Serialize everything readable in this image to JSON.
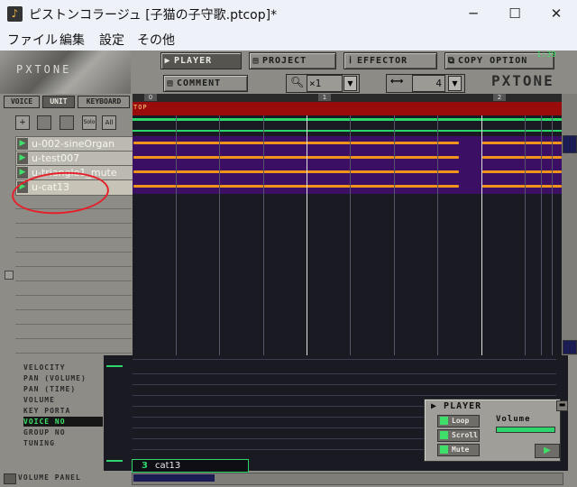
{
  "window": {
    "title": "ピストンコラージュ [子猫の子守歌.ptcop]*",
    "minimize": "─",
    "maximize": "☐",
    "close": "✕"
  },
  "menu": [
    "ファイル",
    "編集",
    "設定",
    "その他"
  ],
  "toolbar": {
    "player": "PLAYER",
    "project": "PROJECT",
    "effector": "EFFECTOR",
    "copy": "COPY",
    "option": "OPTION",
    "comment": "COMMENT",
    "zoom_value": "×1",
    "division_value": "4",
    "brand": "PXTONE",
    "counter": "1:39"
  },
  "left_tabs": [
    "VOICE",
    "UNIT",
    "KEYBOARD"
  ],
  "unit_buttons": [
    "+",
    "Solo",
    "All"
  ],
  "units": [
    {
      "name": "u-002-sineOrgan"
    },
    {
      "name": "u-test007"
    },
    {
      "name": "u-triangle1_mute"
    },
    {
      "name": "u-cat13"
    }
  ],
  "timeline": {
    "bars": [
      "0",
      "1",
      "2"
    ],
    "top_label": "TOP"
  },
  "params": [
    "VELOCITY",
    "PAN (VOLUME)",
    "PAN (TIME)",
    "VOLUME",
    "KEY PORTA",
    "VOICE NO",
    "GROUP NO",
    "TUNING"
  ],
  "active_param": "VOICE NO",
  "voice_indicator": {
    "number": "3",
    "name": "cat13"
  },
  "volume_panel": "VOLUME PANEL",
  "player_panel": {
    "title": "PLAYER",
    "loop": "Loop",
    "scroll": "Scroll",
    "mute": "Mute",
    "volume": "Volume"
  },
  "colors": {
    "accent_green": "#2ed56b",
    "note_orange": "#f0931d",
    "track_purple": "#3a0f64",
    "top_red": "#9a0c0c"
  }
}
